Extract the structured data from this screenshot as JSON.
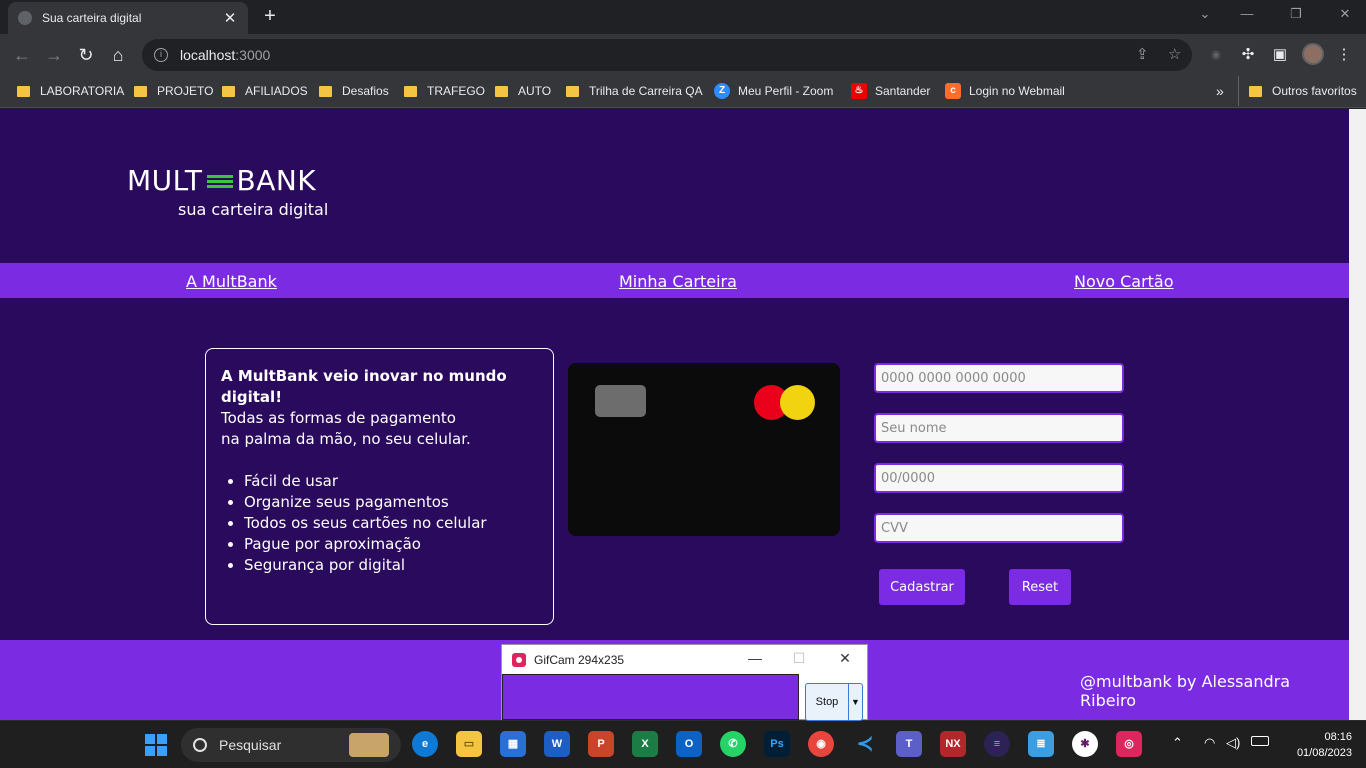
{
  "browser": {
    "tab_title": "Sua carteira digital",
    "url_host": "localhost",
    "url_port": ":3000",
    "new_tab": "+",
    "bookmarks": [
      {
        "label": "LABORATORIA",
        "icon": "folder-icon"
      },
      {
        "label": "PROJETO",
        "icon": "folder-icon"
      },
      {
        "label": "AFILIADOS",
        "icon": "folder-icon"
      },
      {
        "label": "Desafios",
        "icon": "folder-icon"
      },
      {
        "label": "TRAFEGO",
        "icon": "folder-icon"
      },
      {
        "label": "AUTO",
        "icon": "folder-icon"
      },
      {
        "label": "Trilha de Carreira QA",
        "icon": "folder-icon"
      },
      {
        "label": "Meu Perfil - Zoom",
        "icon": "zoom-icon"
      },
      {
        "label": "Santander",
        "icon": "santander-icon"
      },
      {
        "label": "Login no Webmail",
        "icon": "cpanel-icon"
      }
    ],
    "more_bookmarks": "»",
    "other_favorites": "Outros favoritos"
  },
  "page": {
    "logo_left": "MULT",
    "logo_right": "BANK",
    "tagline": "sua carteira digital",
    "nav": {
      "about": "A MultBank",
      "wallet": "Minha Carteira",
      "new_card": "Novo Cartão"
    },
    "info": {
      "headline": "A MultBank veio inovar no mundo digital!",
      "line1": "Todas as formas de pagamento",
      "line2": "na palma da mão, no seu celular.",
      "features": [
        "Fácil de usar",
        "Organize seus pagamentos",
        "Todos os seus cartões no celular",
        "Pague por aproximação",
        "Segurança por digital"
      ]
    },
    "form": {
      "card_number_placeholder": "0000 0000 0000 0000",
      "name_placeholder": "Seu nome",
      "expiry_placeholder": "00/0000",
      "cvv_placeholder": "CVV",
      "submit_label": "Cadastrar",
      "reset_label": "Reset"
    },
    "footer_credit": "@multbank by Alessandra Ribeiro",
    "colors": {
      "background": "#2a0a5c",
      "accent": "#7b2be2",
      "logo_bars": "#3ec43b",
      "mastercard_red": "#eb001b",
      "mastercard_yellow": "#f2d30f"
    }
  },
  "gifcam": {
    "title": "GifCam 294x235",
    "stop_label": "Stop"
  },
  "taskbar": {
    "search_placeholder": "Pesquisar",
    "apps": [
      "edge-icon",
      "file-explorer-icon",
      "store-icon",
      "word-icon",
      "powerpoint-icon",
      "excel-icon",
      "outlook-icon",
      "whatsapp-icon",
      "photoshop-icon",
      "chrome-icon",
      "vscode-icon",
      "teams-icon",
      "nx-icon",
      "eclipse-icon",
      "notepad-icon",
      "slack-icon",
      "gifcam-icon"
    ],
    "time": "08:16",
    "date": "01/08/2023"
  }
}
